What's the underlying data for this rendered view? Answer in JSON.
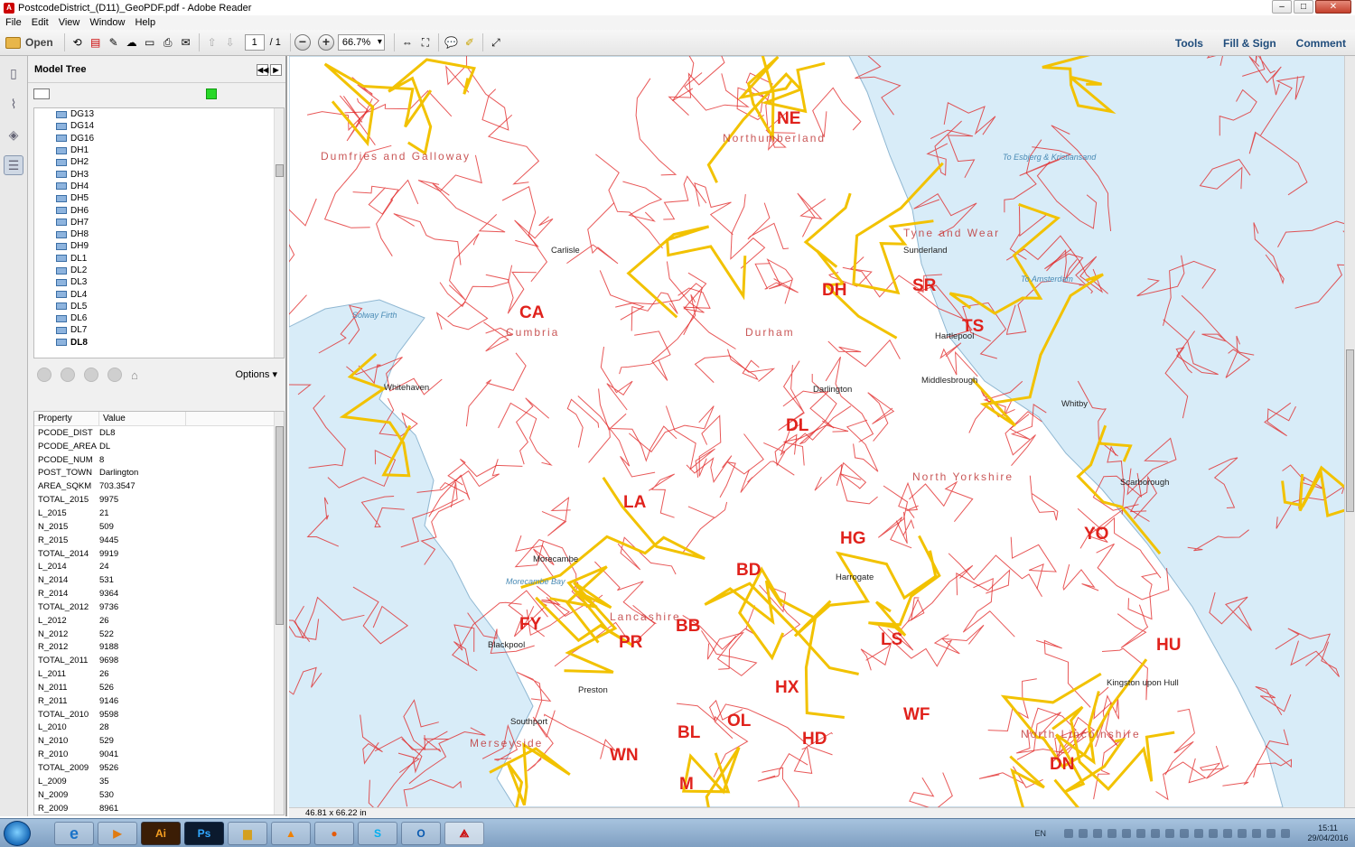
{
  "window": {
    "title": "PostcodeDistrict_(D11)_GeoPDF.pdf - Adobe Reader"
  },
  "menu": [
    "File",
    "Edit",
    "View",
    "Window",
    "Help"
  ],
  "toolbar": {
    "open_label": "Open",
    "page_current": "1",
    "page_total": "/ 1",
    "zoom": "66.7%",
    "right": {
      "tools": "Tools",
      "fill_sign": "Fill & Sign",
      "comment": "Comment"
    }
  },
  "panel": {
    "title": "Model Tree",
    "tree_items": [
      "DG13",
      "DG14",
      "DG16",
      "DH1",
      "DH2",
      "DH3",
      "DH4",
      "DH5",
      "DH6",
      "DH7",
      "DH8",
      "DH9",
      "DL1",
      "DL2",
      "DL3",
      "DL4",
      "DL5",
      "DL6",
      "DL7",
      "DL8"
    ],
    "options_label": "Options",
    "props_headers": {
      "property": "Property",
      "value": "Value"
    },
    "properties": [
      [
        "PCODE_DIST",
        "DL8"
      ],
      [
        "PCODE_AREA",
        "DL"
      ],
      [
        "PCODE_NUM",
        "8"
      ],
      [
        "POST_TOWN",
        "Darlington"
      ],
      [
        "AREA_SQKM",
        "703.3547"
      ],
      [
        "TOTAL_2015",
        "9975"
      ],
      [
        "L_2015",
        "21"
      ],
      [
        "N_2015",
        "509"
      ],
      [
        "R_2015",
        "9445"
      ],
      [
        "TOTAL_2014",
        "9919"
      ],
      [
        "L_2014",
        "24"
      ],
      [
        "N_2014",
        "531"
      ],
      [
        "R_2014",
        "9364"
      ],
      [
        "TOTAL_2012",
        "9736"
      ],
      [
        "L_2012",
        "26"
      ],
      [
        "N_2012",
        "522"
      ],
      [
        "R_2012",
        "9188"
      ],
      [
        "TOTAL_2011",
        "9698"
      ],
      [
        "L_2011",
        "26"
      ],
      [
        "N_2011",
        "526"
      ],
      [
        "R_2011",
        "9146"
      ],
      [
        "TOTAL_2010",
        "9598"
      ],
      [
        "L_2010",
        "28"
      ],
      [
        "N_2010",
        "529"
      ],
      [
        "R_2010",
        "9041"
      ],
      [
        "TOTAL_2009",
        "9526"
      ],
      [
        "L_2009",
        "35"
      ],
      [
        "N_2009",
        "530"
      ],
      [
        "R_2009",
        "8961"
      ]
    ]
  },
  "map": {
    "area_codes": [
      "NE",
      "CA",
      "DH",
      "SR",
      "TS",
      "DL",
      "YO",
      "HG",
      "BD",
      "LA",
      "FY",
      "PR",
      "BB",
      "LS",
      "HU",
      "HX",
      "WF",
      "OL",
      "BL",
      "HD",
      "DN",
      "WN",
      "M"
    ],
    "region_names": [
      "Northumberland",
      "Dumfries and Galloway",
      "Cumbria",
      "Durham",
      "North Yorkshire",
      "Lancashire",
      "Tyne and Wear",
      "Merseyside",
      "North Lincolnshire"
    ],
    "places": [
      "Sunderland",
      "Hartlepool",
      "Darlington",
      "Harrogate",
      "Scarborough",
      "Blackpool",
      "Preston",
      "Kingston upon Hull",
      "Whitehaven",
      "Morecambe",
      "Whitby",
      "Southport",
      "Middlesbrough",
      "Carlisle"
    ],
    "sea_labels": [
      "Solway Firth",
      "Morecambe Bay",
      "To Amsterdam",
      "To Esbjerg & Kristiansand"
    ],
    "colors": {
      "land": "#ffffff",
      "sea": "#d8ecf8",
      "district_border": "#e02020",
      "area_border": "#f2c200",
      "area_label": "#e0221c"
    }
  },
  "statusbar": {
    "page_size": "46.81 x 66.22 in"
  },
  "taskbar": {
    "apps": [
      "Ai",
      "Ps"
    ],
    "lang": "EN",
    "time": "15:11",
    "date": "29/04/2016"
  }
}
